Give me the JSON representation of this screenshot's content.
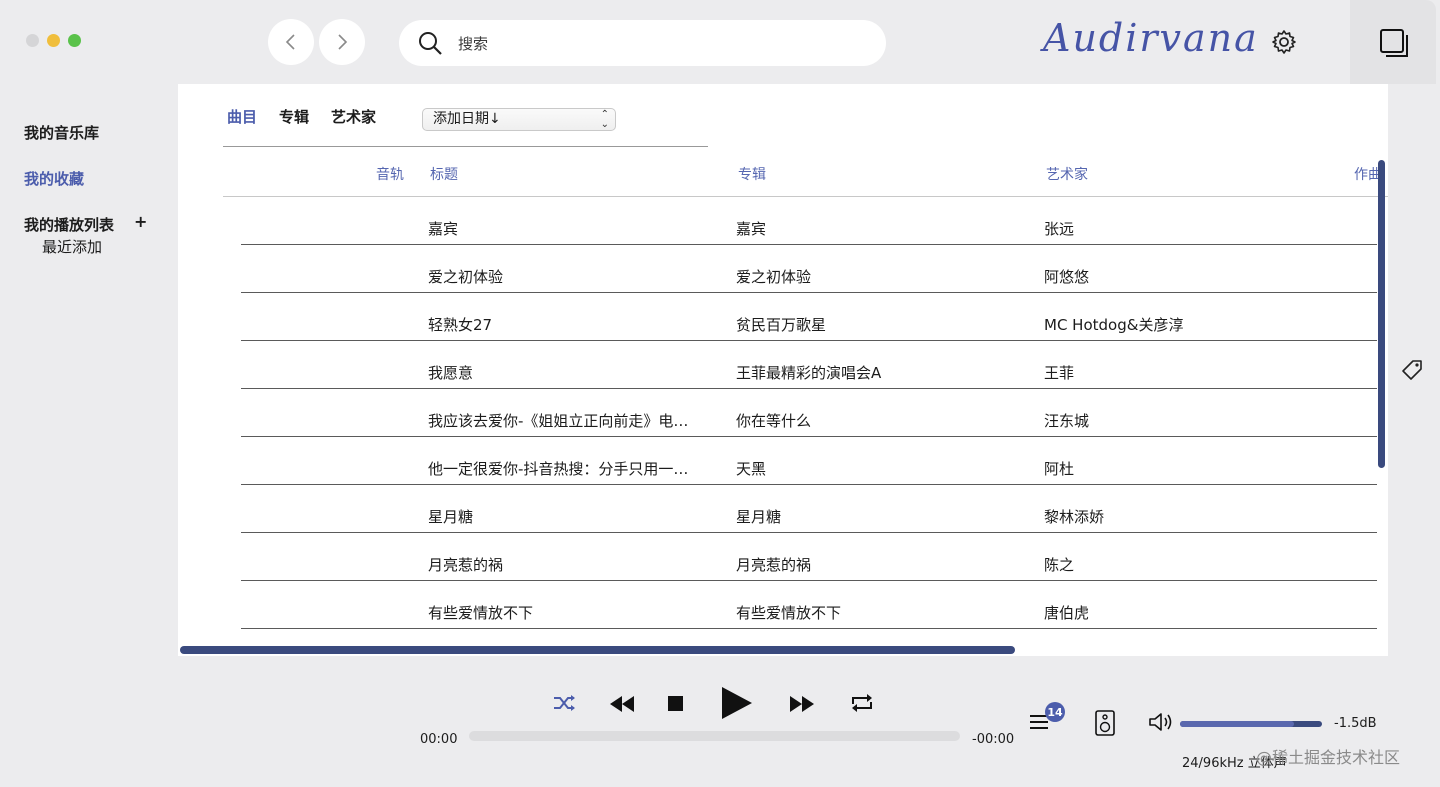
{
  "titlebar": {
    "search_placeholder": "搜索",
    "brand": "Audirvana",
    "icons": [
      "chevron-left-icon",
      "chevron-right-icon",
      "search-icon",
      "gear-icon",
      "window-icon"
    ]
  },
  "sidebar": {
    "library": "我的音乐库",
    "favorites": "我的收藏",
    "playlists": "我的播放列表",
    "add_playlist": "+",
    "recent": "最近添加"
  },
  "main": {
    "tabs": [
      "曲目",
      "专辑",
      "艺术家"
    ],
    "active_tab": "曲目",
    "sort_value": "添加日期↓",
    "columns": {
      "track": "音轨",
      "title": "标题",
      "album": "专辑",
      "artist": "艺术家",
      "composer": "作曲"
    },
    "rows": [
      {
        "title": "嘉宾",
        "album": "嘉宾",
        "artist": "张远"
      },
      {
        "title": "爱之初体验",
        "album": "爱之初体验",
        "artist": "阿悠悠"
      },
      {
        "title": "轻熟女27",
        "album": "贫民百万歌星",
        "artist": "MC Hotdog&关彦淳"
      },
      {
        "title": "我愿意",
        "album": "王菲最精彩的演唱会A",
        "artist": "王菲"
      },
      {
        "title": "我应该去爱你-《姐姐立正向前走》电…",
        "album": "你在等什么",
        "artist": "汪东城"
      },
      {
        "title": "他一定很爱你-抖音热搜：分手只用一…",
        "album": "天黑",
        "artist": "阿杜"
      },
      {
        "title": "星月糖",
        "album": "星月糖",
        "artist": "黎林添娇"
      },
      {
        "title": "月亮惹的祸",
        "album": "月亮惹的祸",
        "artist": "陈之"
      },
      {
        "title": "有些爱情放不下",
        "album": "有些爱情放不下",
        "artist": "唐伯虎"
      }
    ]
  },
  "player": {
    "time_elapsed": "00:00",
    "time_remaining": "-00:00",
    "queue_count": "14",
    "volume_db": "-1.5dB",
    "volume_level": 0.8,
    "format": "24/96kHz 立体声",
    "watermark": "@稀土掘金技术社区",
    "accent_color": "#4c5dac"
  }
}
